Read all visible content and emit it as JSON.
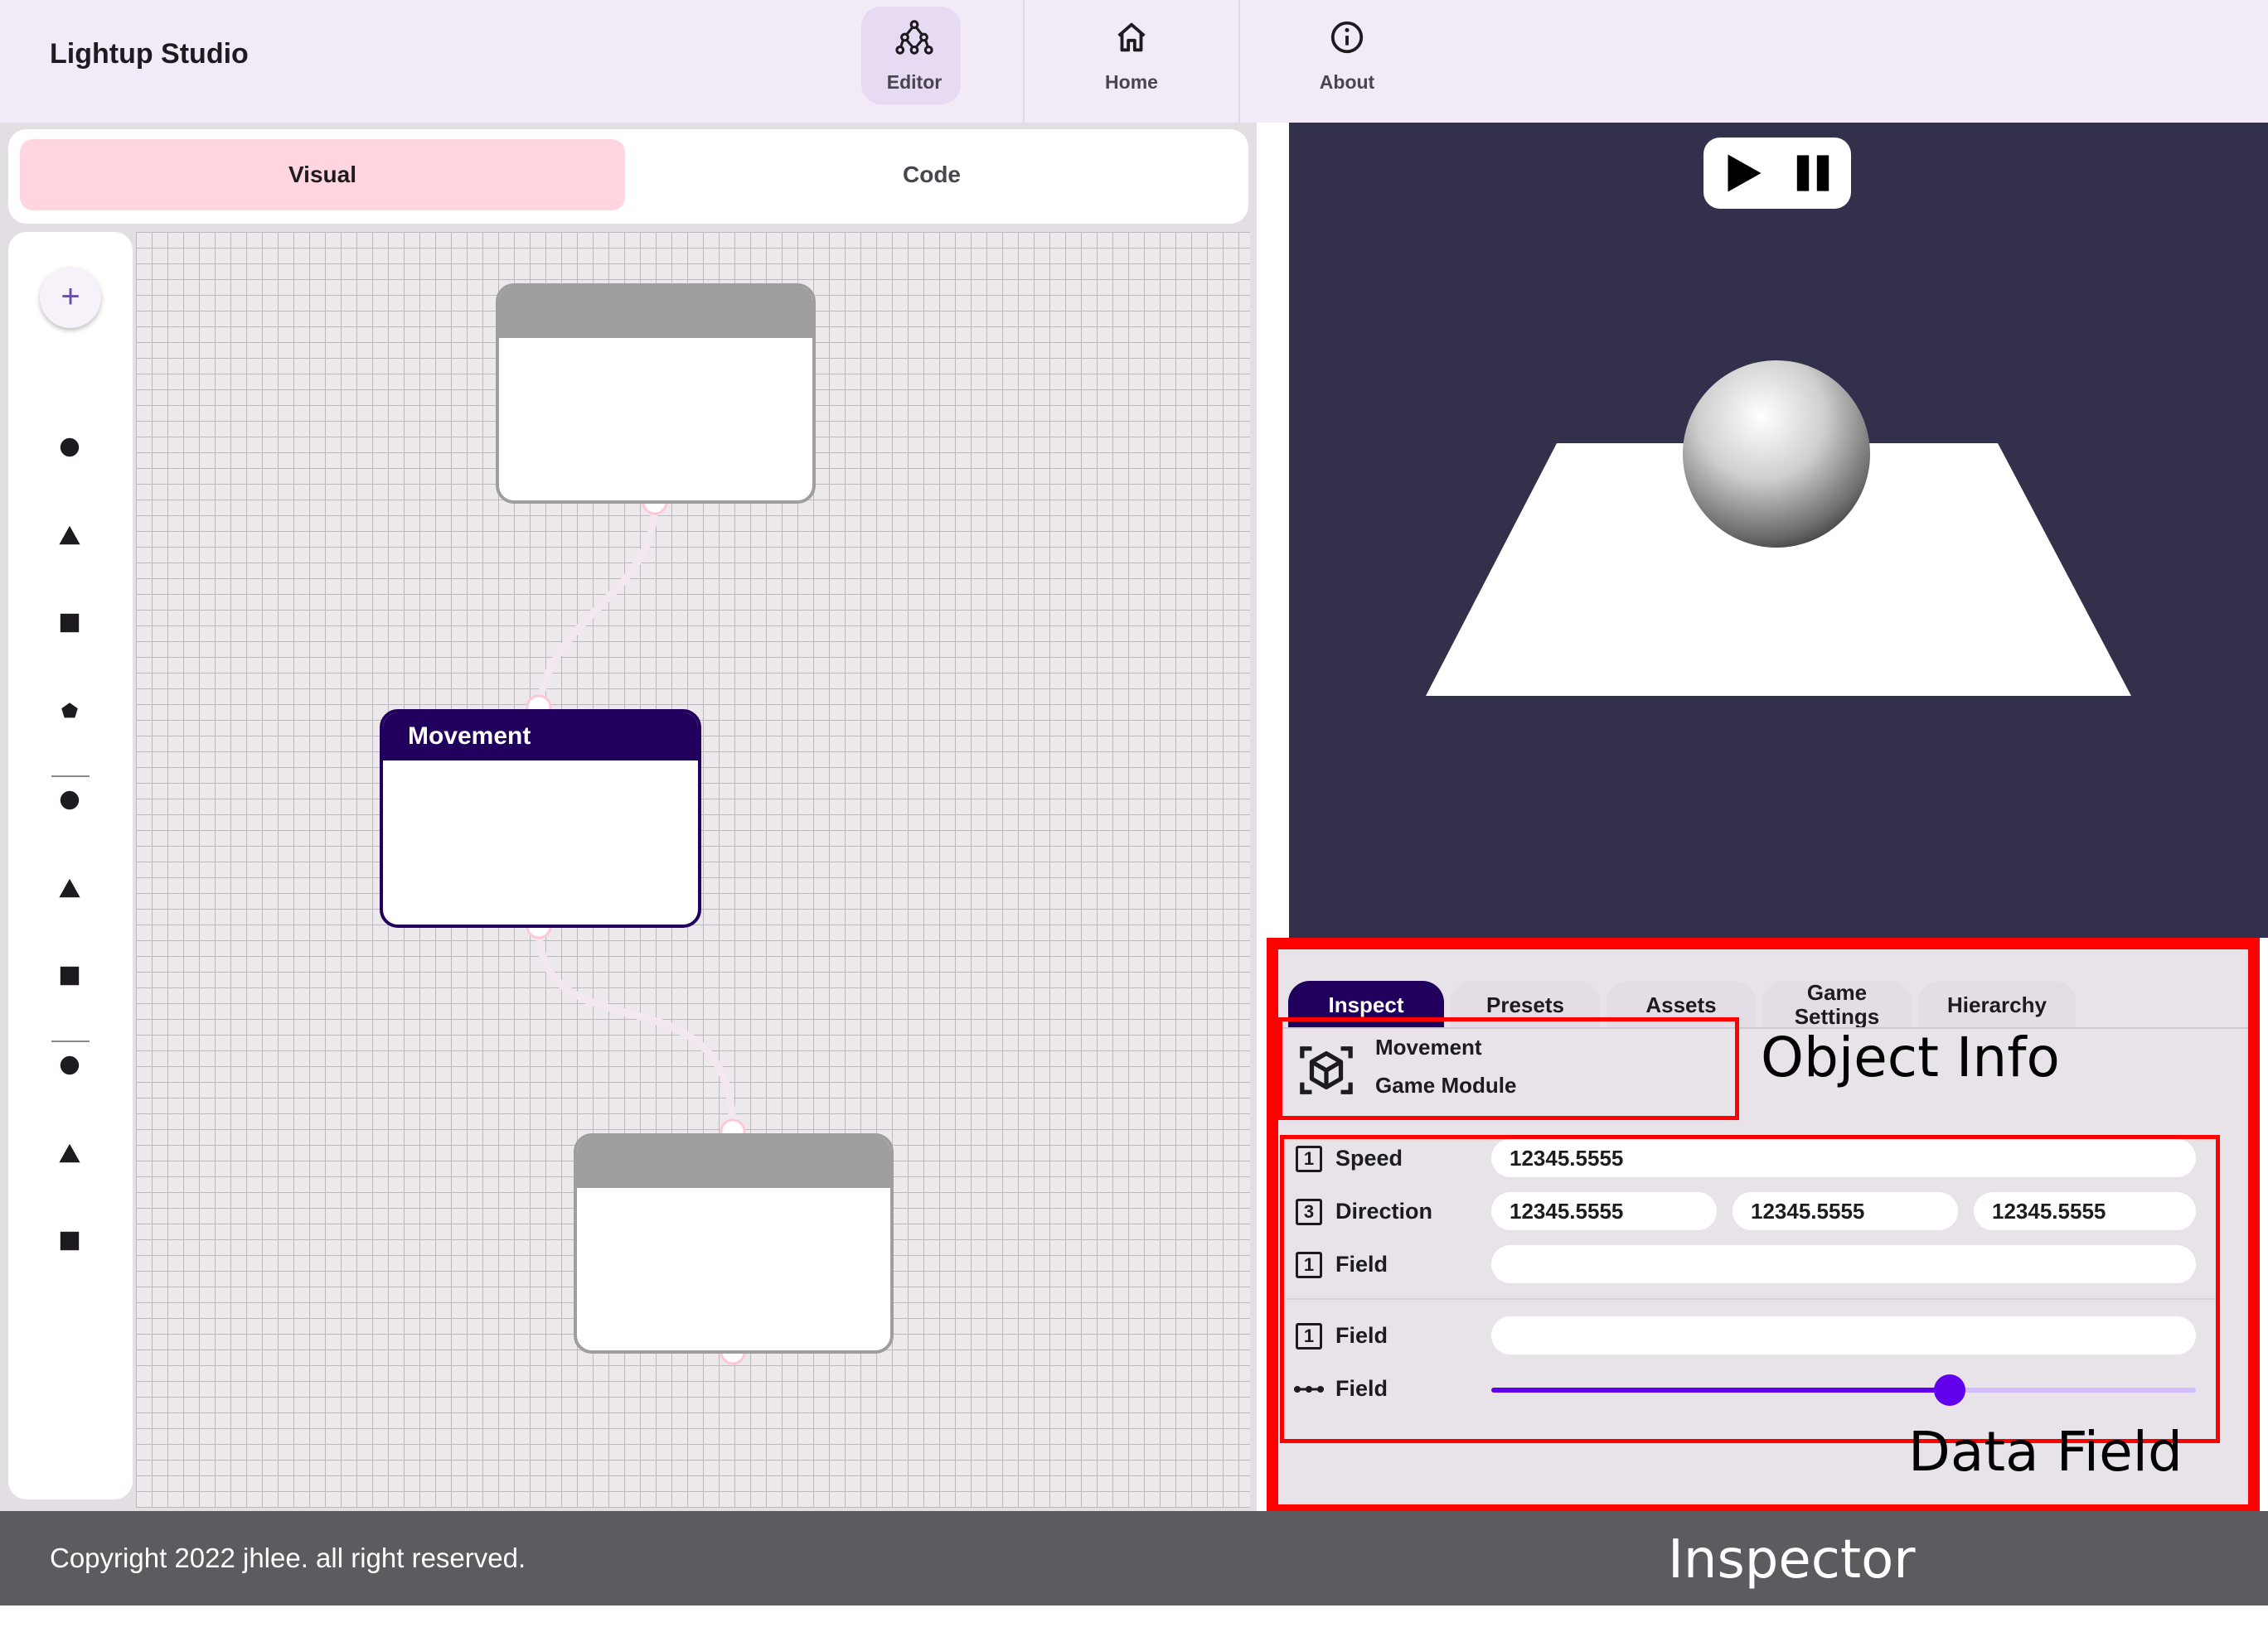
{
  "app": {
    "title": "Lightup Studio"
  },
  "nav": {
    "items": [
      {
        "label": "Editor",
        "icon": "editor-icon",
        "active": true
      },
      {
        "label": "Home",
        "icon": "home-icon",
        "active": false
      },
      {
        "label": "About",
        "icon": "info-icon",
        "active": false
      }
    ]
  },
  "editor": {
    "tabs": [
      {
        "label": "Visual",
        "active": true
      },
      {
        "label": "Code",
        "active": false
      }
    ],
    "add_label": "+",
    "nodes": [
      {
        "title": ""
      },
      {
        "title": "Movement"
      },
      {
        "title": ""
      }
    ]
  },
  "viewport": {
    "controls": [
      "play-icon",
      "pause-icon"
    ]
  },
  "inspector": {
    "tabs": [
      {
        "label": "Inspect",
        "active": true
      },
      {
        "label": "Presets",
        "active": false
      },
      {
        "label": "Assets",
        "active": false
      },
      {
        "label_line1": "Game",
        "label_line2": "Settings",
        "active": false
      },
      {
        "label": "Hierarchy",
        "active": false
      }
    ],
    "object": {
      "name": "Movement",
      "type": "Game Module",
      "icon": "cube-icon"
    },
    "fields": [
      {
        "dim": "1",
        "label": "Speed",
        "values": [
          "12345.5555"
        ]
      },
      {
        "dim": "3",
        "label": "Direction",
        "values": [
          "12345.5555",
          "12345.5555",
          "12345.5555"
        ]
      },
      {
        "dim": "1",
        "label": "Field",
        "values": [
          ""
        ]
      },
      {
        "dim": "1",
        "label": "Field",
        "values": [
          ""
        ]
      },
      {
        "dim": "slider",
        "label": "Field",
        "slider_fraction": 0.65
      }
    ]
  },
  "annotations": {
    "object_info": "Object Info",
    "data_field": "Data Field",
    "inspector": "Inspector"
  },
  "footer": {
    "copyright": "Copyright 2022 jhlee. all right reserved."
  },
  "colors": {
    "accent_purple": "#21005d",
    "slider": "#6200ee",
    "visual_tab": "#ffd5df",
    "annotation_red": "#ff0000"
  }
}
